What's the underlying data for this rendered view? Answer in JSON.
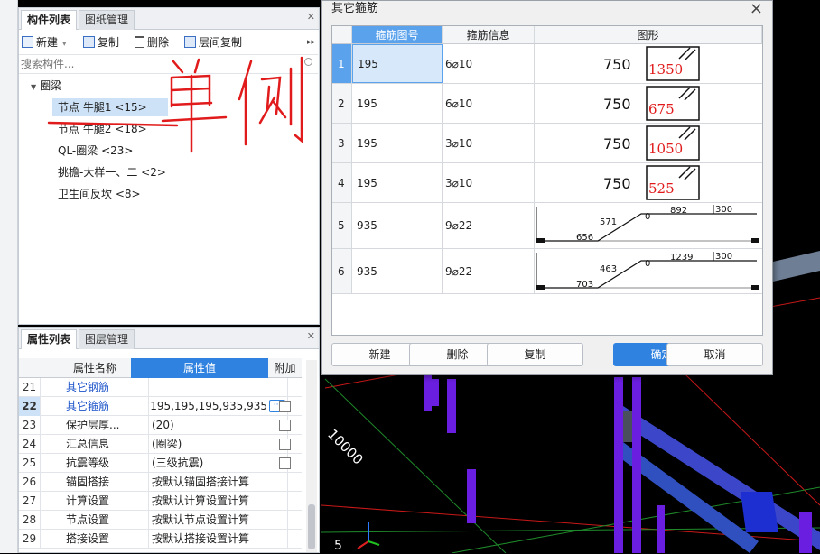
{
  "colors": {
    "accent": "#2f82e0",
    "link_blue": "#1a52c9",
    "scene_bg": "#000000",
    "rebar_purple": "#6a1fe0",
    "annotation_red": "#e11b1b"
  },
  "component_panel": {
    "tabs": [
      "构件列表",
      "图纸管理"
    ],
    "toolbar": {
      "new": "新建",
      "copy": "复制",
      "delete": "删除",
      "floor_copy": "层间复制",
      "more": "▸▸"
    },
    "search_placeholder": "搜索构件...",
    "tree": {
      "group": "圈梁",
      "items": [
        "节点 牛腿1 <15>",
        "节点 牛腿2 <18>",
        "QL-圈梁 <23>",
        "挑檐-大样一、二 <2>",
        "卫生间反坎 <8>"
      ]
    },
    "annotation": "单侧"
  },
  "property_panel": {
    "tabs": [
      "属性列表",
      "图层管理"
    ],
    "headers": {
      "name": "属性名称",
      "value": "属性值",
      "extra": "附加"
    },
    "rows": [
      {
        "num": "21",
        "name": "其它钢筋",
        "value": "",
        "check": false,
        "blue": true
      },
      {
        "num": "22",
        "name": "其它箍筋",
        "value": "5,195,195,195,935,935",
        "check": true,
        "blue": true,
        "selected": true
      },
      {
        "num": "23",
        "name": "保护层厚...",
        "value": "(20)",
        "check": true
      },
      {
        "num": "24",
        "name": "汇总信息",
        "value": "(圈梁)",
        "check": true
      },
      {
        "num": "25",
        "name": "抗震等级",
        "value": "(三级抗震)",
        "check": true
      },
      {
        "num": "26",
        "name": "锚固搭接",
        "value": "按默认锚固搭接计算",
        "check": false
      },
      {
        "num": "27",
        "name": "计算设置",
        "value": "按默认计算设置计算",
        "check": false
      },
      {
        "num": "28",
        "name": "节点设置",
        "value": "按默认节点设置计算",
        "check": false
      },
      {
        "num": "29",
        "name": "搭接设置",
        "value": "按默认搭接设置计算",
        "check": false
      }
    ],
    "ellipsis": "···"
  },
  "dialog": {
    "title": "其它箍筋",
    "close": "×",
    "headers": {
      "shape_no": "箍筋图号",
      "info": "箍筋信息",
      "figure": "图形"
    },
    "rows": [
      {
        "n": "1",
        "shape": "195",
        "info": "6⌀10",
        "fig_type": "stirrup",
        "w": "750",
        "h": "1350"
      },
      {
        "n": "2",
        "shape": "195",
        "info": "6⌀10",
        "fig_type": "stirrup",
        "w": "750",
        "h": "675"
      },
      {
        "n": "3",
        "shape": "195",
        "info": "3⌀10",
        "fig_type": "stirrup",
        "w": "750",
        "h": "1050"
      },
      {
        "n": "4",
        "shape": "195",
        "info": "3⌀10",
        "fig_type": "stirrup",
        "w": "750",
        "h": "525"
      },
      {
        "n": "5",
        "shape": "935",
        "info": "9⌀22",
        "fig_type": "bent",
        "a": "571",
        "b": "0",
        "c": "892",
        "d": "300",
        "e": "656"
      },
      {
        "n": "6",
        "shape": "935",
        "info": "9⌀22",
        "fig_type": "bent",
        "a": "463",
        "b": "0",
        "c": "1239",
        "d": "300",
        "e": "703"
      }
    ],
    "buttons": {
      "new": "新建",
      "delete": "删除",
      "copy": "复制",
      "ok": "确定",
      "cancel": "取消"
    }
  },
  "scene": {
    "dimension": "10000",
    "axis_label": "5"
  }
}
